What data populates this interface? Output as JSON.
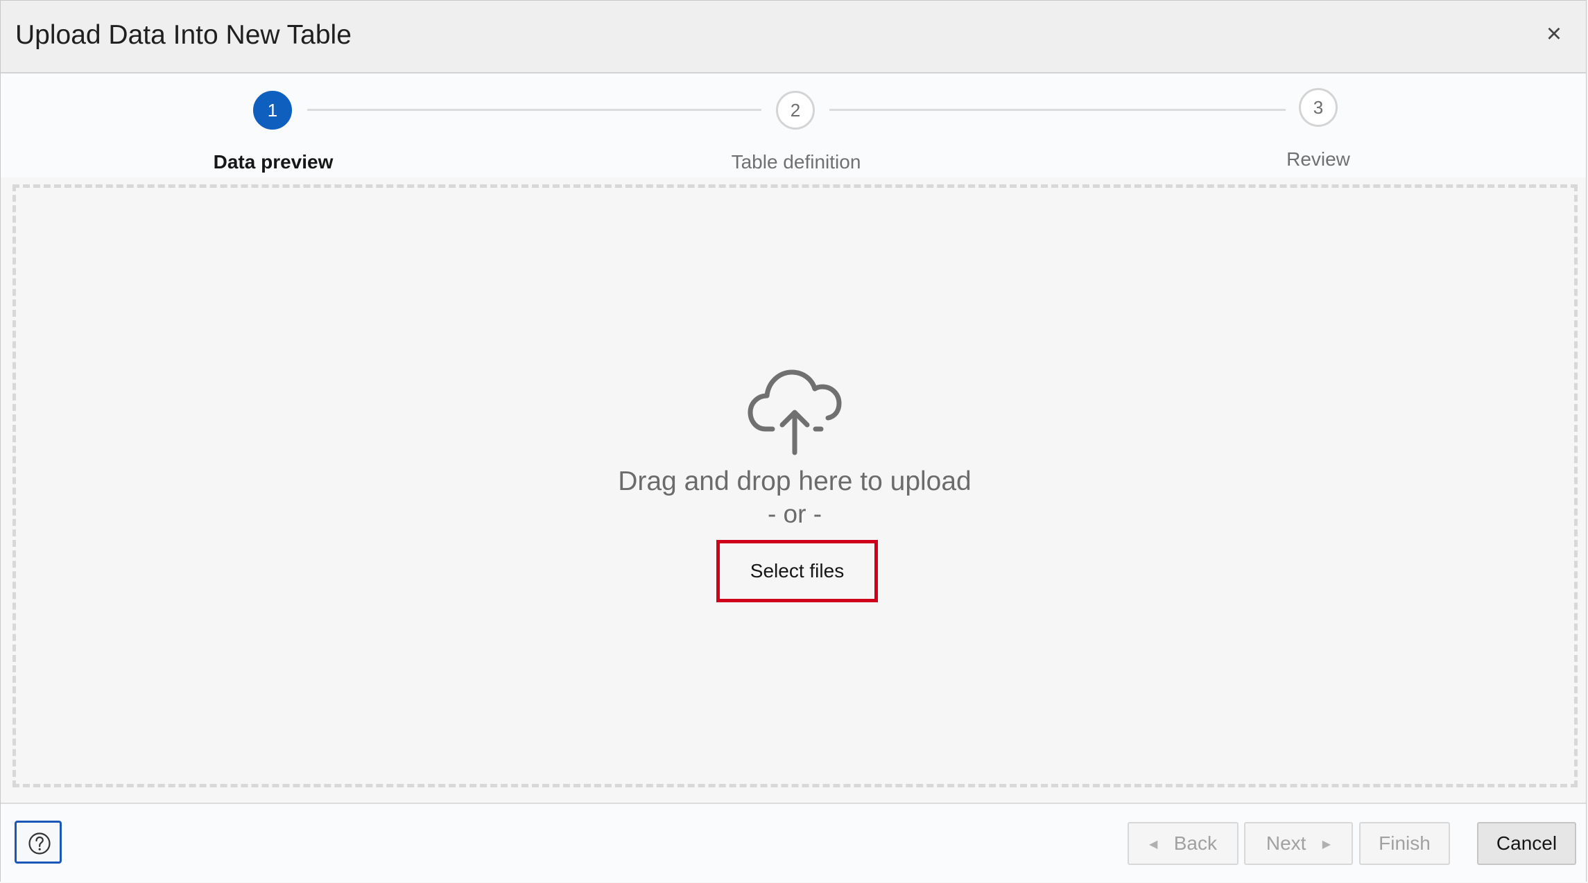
{
  "dialog": {
    "title": "Upload Data Into New Table",
    "close_glyph": "×"
  },
  "train": {
    "steps": [
      {
        "number": "1",
        "label": "Data preview",
        "state": "active"
      },
      {
        "number": "2",
        "label": "Table definition",
        "state": "pending"
      },
      {
        "number": "3",
        "label": "Review",
        "state": "pending"
      }
    ]
  },
  "dropzone": {
    "icon": "cloud-upload-icon",
    "primary_text": "Drag and drop here to upload",
    "secondary_text": "- or -",
    "select_button_label": "Select files"
  },
  "footer": {
    "help_icon": "question-circle-icon",
    "back_label": "Back",
    "next_label": "Next",
    "finish_label": "Finish",
    "cancel_label": "Cancel"
  },
  "colors": {
    "accent": "#0f5fbf",
    "highlight_border": "#d0021b"
  }
}
